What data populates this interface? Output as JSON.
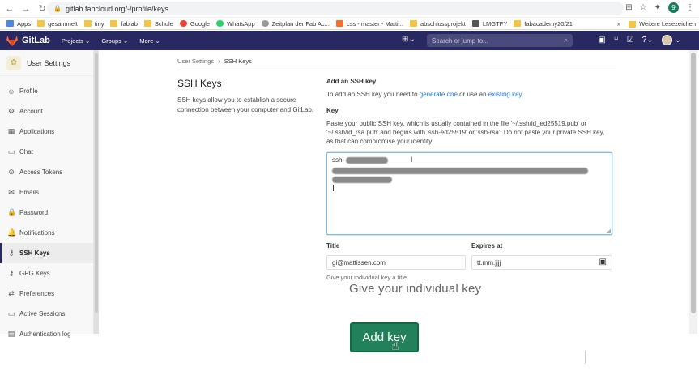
{
  "browser": {
    "url": "gitlab.fabcloud.org/-/profile/keys",
    "profile_initial": "9",
    "bookmarks": [
      "Apps",
      "gesammelt",
      "tiny",
      "fablab",
      "Schule",
      "Google",
      "WhatsApp",
      "Zeitplan der Fab Ac...",
      "css - master - Matti...",
      "abschlussprojekt",
      "LMGTFY",
      "fabacademy20/21"
    ],
    "more_chevron": "»",
    "other_bookmarks": "Weitere Lesezeichen"
  },
  "header": {
    "brand": "GitLab",
    "menu": [
      "Projects",
      "Groups",
      "More"
    ],
    "search_placeholder": "Search or jump to..."
  },
  "sidebar": {
    "title": "User Settings",
    "items": [
      {
        "label": "Profile",
        "icon": "profile-icon"
      },
      {
        "label": "Account",
        "icon": "account-icon"
      },
      {
        "label": "Applications",
        "icon": "applications-icon"
      },
      {
        "label": "Chat",
        "icon": "chat-icon"
      },
      {
        "label": "Access Tokens",
        "icon": "token-icon"
      },
      {
        "label": "Emails",
        "icon": "email-icon"
      },
      {
        "label": "Password",
        "icon": "lock-icon"
      },
      {
        "label": "Notifications",
        "icon": "bell-icon"
      },
      {
        "label": "SSH Keys",
        "icon": "key-icon"
      },
      {
        "label": "GPG Keys",
        "icon": "key-icon"
      },
      {
        "label": "Preferences",
        "icon": "preferences-icon"
      },
      {
        "label": "Active Sessions",
        "icon": "monitor-icon"
      },
      {
        "label": "Authentication log",
        "icon": "log-icon"
      }
    ]
  },
  "breadcrumb": {
    "parent": "User Settings",
    "separator": "›",
    "current": "SSH Keys"
  },
  "intro": {
    "title": "SSH Keys",
    "description": "SSH keys allow you to establish a secure connection between your computer and GitLab."
  },
  "form": {
    "add_heading": "Add an SSH key",
    "add_text_1": "To add an SSH key you need to",
    "generate_link": "generate one",
    "add_text_2": "or use an",
    "existing_link": "existing key",
    "add_text_3": ".",
    "key_label": "Key",
    "key_help": "Paste your public SSH key, which is usually contained in the file '~/.ssh/id_ed25519.pub' or '~/.ssh/id_rsa.pub' and begins with 'ssh-ed25519' or 'ssh-rsa'. Do not paste your private SSH key, as that can compromise your identity.",
    "key_prefix": "ssh-",
    "title_label": "Title",
    "title_value": "gi@mattissen.com",
    "expires_label": "Expires at",
    "expires_value": "tt.mm.jjjj",
    "title_hint": "Give your individual key a title."
  },
  "overlay": {
    "caption": "Give your individual key",
    "button": "Add key"
  }
}
